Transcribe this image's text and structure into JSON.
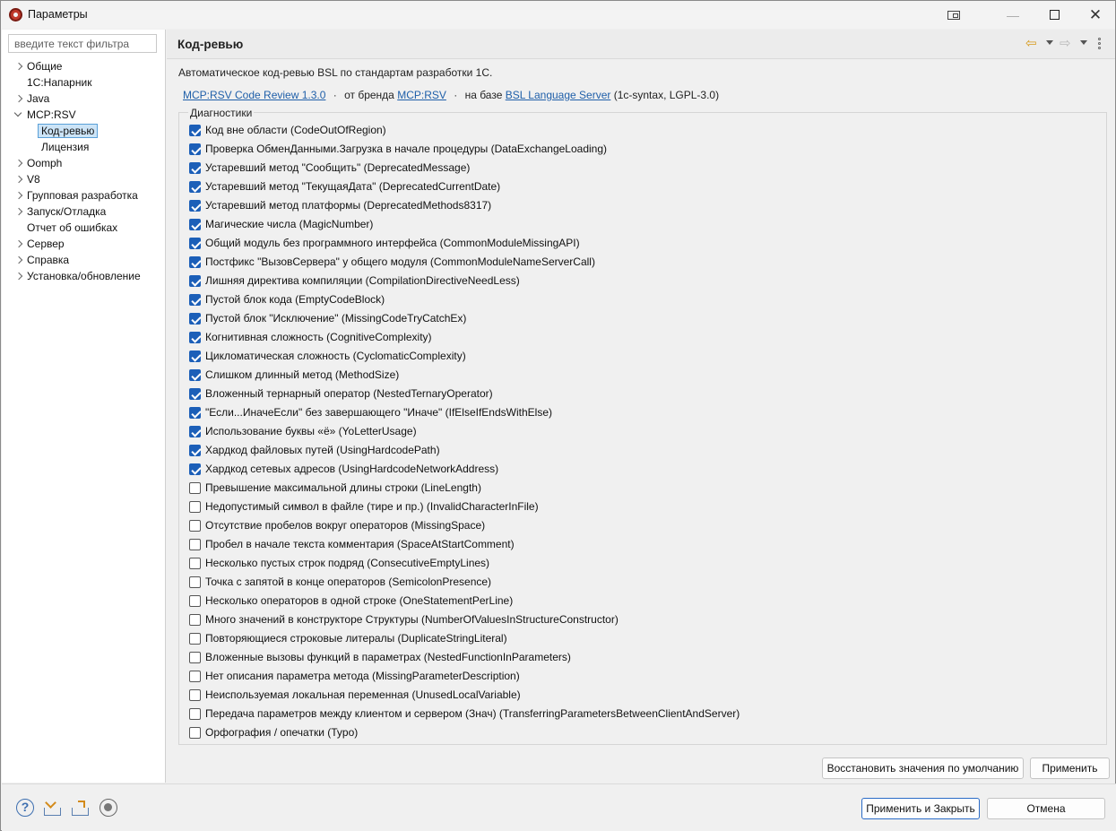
{
  "window": {
    "title": "Параметры"
  },
  "sidebar": {
    "filter_placeholder": "введите текст фильтра",
    "items": [
      {
        "label": "Общие",
        "expander": "collapsed"
      },
      {
        "label": "1С:Напарник",
        "expander": "none"
      },
      {
        "label": "Java",
        "expander": "collapsed"
      },
      {
        "label": "MCP:RSV",
        "expander": "expanded"
      },
      {
        "label": "Код-ревью",
        "expander": "child",
        "selected": true
      },
      {
        "label": "Лицензия",
        "expander": "child"
      },
      {
        "label": "Oomph",
        "expander": "collapsed"
      },
      {
        "label": "V8",
        "expander": "collapsed"
      },
      {
        "label": "Групповая разработка",
        "expander": "collapsed"
      },
      {
        "label": "Запуск/Отладка",
        "expander": "collapsed"
      },
      {
        "label": "Отчет  об ошибках",
        "expander": "none"
      },
      {
        "label": "Сервер",
        "expander": "collapsed"
      },
      {
        "label": "Справка",
        "expander": "collapsed"
      },
      {
        "label": "Установка/обновление",
        "expander": "collapsed"
      }
    ]
  },
  "page": {
    "title": "Код-ревью",
    "description": "Автоматическое код-ревью BSL по стандартам разработки 1С.",
    "links": {
      "product_link": "MCP:RSV Code Review 1.3.0",
      "sep": "·",
      "brand_prefix": "от бренда",
      "brand_link": "MCP:RSV",
      "base_prefix": "на базе",
      "base_link": "BSL Language Server",
      "base_suffix": "(1c-syntax, LGPL-3.0)"
    },
    "group_label": "Диагностики",
    "diagnostics": [
      {
        "text": "Код вне области  (CodeOutOfRegion)",
        "checked": true
      },
      {
        "text": "Проверка ОбменДанными.Загрузка в начале процедуры  (DataExchangeLoading)",
        "checked": true
      },
      {
        "text": "Устаревший метод \"Сообщить\"  (DeprecatedMessage)",
        "checked": true
      },
      {
        "text": "Устаревший метод \"ТекущаяДата\"  (DeprecatedCurrentDate)",
        "checked": true
      },
      {
        "text": "Устаревший метод платформы  (DeprecatedMethods8317)",
        "checked": true
      },
      {
        "text": "Магические числа  (MagicNumber)",
        "checked": true
      },
      {
        "text": "Общий модуль без программного интерфейса  (CommonModuleMissingAPI)",
        "checked": true
      },
      {
        "text": "Постфикс \"ВызовСервера\" у общего модуля  (CommonModuleNameServerCall)",
        "checked": true
      },
      {
        "text": "Лишняя директива компиляции  (CompilationDirectiveNeedLess)",
        "checked": true
      },
      {
        "text": "Пустой блок кода  (EmptyCodeBlock)",
        "checked": true
      },
      {
        "text": "Пустой блок \"Исключение\"  (MissingCodeTryCatchEx)",
        "checked": true
      },
      {
        "text": "Когнитивная сложность  (CognitiveComplexity)",
        "checked": true
      },
      {
        "text": "Цикломатическая сложность  (CyclomaticComplexity)",
        "checked": true
      },
      {
        "text": "Слишком длинный метод  (MethodSize)",
        "checked": true
      },
      {
        "text": "Вложенный тернарный оператор  (NestedTernaryOperator)",
        "checked": true
      },
      {
        "text": "\"Если...ИначеЕсли\" без завершающего \"Иначе\"  (IfElseIfEndsWithElse)",
        "checked": true
      },
      {
        "text": "Использование буквы «ё»  (YoLetterUsage)",
        "checked": true
      },
      {
        "text": "Хардкод файловых путей  (UsingHardcodePath)",
        "checked": true
      },
      {
        "text": "Хардкод сетевых адресов  (UsingHardcodeNetworkAddress)",
        "checked": true
      },
      {
        "text": "Превышение максимальной длины строки  (LineLength)",
        "checked": false
      },
      {
        "text": "Недопустимый символ в файле (тире и пр.)  (InvalidCharacterInFile)",
        "checked": false
      },
      {
        "text": "Отсутствие пробелов вокруг операторов  (MissingSpace)",
        "checked": false
      },
      {
        "text": "Пробел в начале текста комментария  (SpaceAtStartComment)",
        "checked": false
      },
      {
        "text": "Несколько пустых строк подряд  (ConsecutiveEmptyLines)",
        "checked": false
      },
      {
        "text": "Точка с запятой в конце операторов  (SemicolonPresence)",
        "checked": false
      },
      {
        "text": "Несколько операторов в одной строке  (OneStatementPerLine)",
        "checked": false
      },
      {
        "text": "Много значений в конструкторе Структуры  (NumberOfValuesInStructureConstructor)",
        "checked": false
      },
      {
        "text": "Повторяющиеся строковые литералы  (DuplicateStringLiteral)",
        "checked": false
      },
      {
        "text": "Вложенные вызовы функций в параметрах  (NestedFunctionInParameters)",
        "checked": false
      },
      {
        "text": "Нет описания параметра метода  (MissingParameterDescription)",
        "checked": false
      },
      {
        "text": "Неиспользуемая локальная переменная  (UnusedLocalVariable)",
        "checked": false
      },
      {
        "text": "Передача параметров между клиентом и сервером (Знач)  (TransferringParametersBetweenClientAndServer)",
        "checked": false
      },
      {
        "text": "Орфография / опечатки  (Typo)",
        "checked": false
      }
    ],
    "restore_defaults_label": "Восстановить значения по умолчанию",
    "apply_label": "Применить"
  },
  "footer": {
    "apply_close_label": "Применить и Закрыть",
    "cancel_label": "Отмена",
    "icons": [
      "help-icon",
      "import-icon",
      "export-icon",
      "record-icon"
    ]
  },
  "colors": {
    "checkbox_checked": "#1c5fb8",
    "link": "#1f5fa9",
    "selection": "#cce4f7"
  }
}
